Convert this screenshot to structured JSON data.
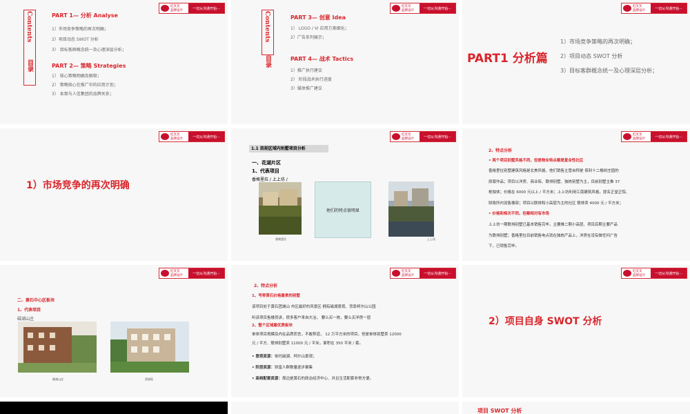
{
  "header": {
    "slogan": "一切从沟通开始···",
    "brand_line1": "红叉叉",
    "brand_line2": "品牌设计"
  },
  "toc": {
    "mulu": "目录",
    "contents": "Contents",
    "part1": {
      "title": "PART 1— 分析  Analyse",
      "items": [
        "1）市场竞争策略的再次明确；",
        "2）项目动态 SWOT 分析",
        "3）  目标客群概念统一及心理深层分析；"
      ]
    },
    "part2": {
      "title": "PART 2— 策略  Strategies",
      "items": [
        "1）   核心策略明确及解释；",
        "2）   策略核心在推广中的应用计划；",
        "3）   本案与人信集团的品牌关系；"
      ]
    },
    "part3": {
      "title": "PART 3— 创意  Idea",
      "items": [
        "1）  LOGO / VI  应用方案细化；",
        "2）广告系列展示；"
      ]
    },
    "part4": {
      "title": "PART 4— 战术  Tactics",
      "items": [
        "1）推广执行建议",
        "2）  阶段战术执行进度",
        "3）媒体推广建议"
      ]
    }
  },
  "part1slide": {
    "title": "PART1   分析篇",
    "items": [
      "1）市场竞争策略的再次明确；",
      "2）项目动态 SWOT 分析",
      "3）目标客群概念统一及心理深层分析；"
    ]
  },
  "s4": {
    "title": "1）市场竞争的再次明确"
  },
  "s5": {
    "heading": "1.1   目前区域内别墅项目分析",
    "sub1": "一、花湖片区",
    "sub2": "1、代表项目",
    "sub3": "香格里拉  /     上上坊  /",
    "box": "他们的特点很明显",
    "cap1": "香格里拉",
    "cap2": "上上坊"
  },
  "s6": {
    "h": "2、特点分析",
    "b1": "• 两个项目别墅风格不同，但是物业特点都是复合性社区",
    "lines1": [
      "香格里拉别墅建筑风格是北美风格，他们销售主管自称是 保利十二橡树庄园的",
      "原版作品；项目以洋房、商业街、联排别墅、独栋别墅为主，目前别墅主推 37",
      "栋独体；价格在 6000 元以上 / 平方米；上上坊利用江南建筑风格，提名正堂正院、",
      "财政所内设售楼部；项目以联排和小高层为主的社区 联排卖 4000 元 / 平方米；"
    ],
    "b2": "• 价格和档次不同，但都相对有市场",
    "lines2": [
      "上上坊一期联排别墅已基本销售完毕，主要推二期小高层、项目后期主要产品",
      "为联排别墅；香格里拉目前销售电点就在独栋产品上，洋房在没有做任何广告",
      "下，已销售完毕。"
    ]
  },
  "s7": {
    "h1": "二、黄石中心区板块",
    "h2": "1、代表项目",
    "h3": "磁湖山庄",
    "cap1": "磁湖山庄",
    "cap2": "滨湖苑"
  },
  "s8": {
    "h": "2、特点分析",
    "p1": "1、号称黄石价格最贵的别墅",
    "lines1": [
      "该项目处于黄石团城山 市区最好的风景区  拥有磁湖景观、背靠柯尔山公园",
      "听该项目售楼员讲，很多客户来自大冶，  要么买一栋，要么买洋房一层"
    ],
    "p2": "2、整个区域最优质板块",
    "lines2": [
      "单体项目规模及内在品质而言，不敢称道，  12 万平方米的项目，但是单体别墅卖 12000",
      "元 / 平方、联排别墅卖 11000 元 / 平米，面积在 350 平米 / 套。"
    ],
    "bul": [
      {
        "k": "• 景观资源：",
        "v": "依托磁湖、柯尔山景观；"
      },
      {
        "k": "• 阶层资源：",
        "v": "财富人群数量逐步聚集"
      },
      {
        "k": "• 高档配套资源：",
        "v": "周边是黄石的政治经济中心、并且生活配套非常方便。"
      }
    ]
  },
  "s9": {
    "title": "2）项目自身 SWOT 分析"
  },
  "s12": {
    "title": "项目 SWOT 分析"
  },
  "colors": {
    "accent": "#d9252b",
    "bg": "#f7f7f7",
    "gap": "#ffffff"
  }
}
